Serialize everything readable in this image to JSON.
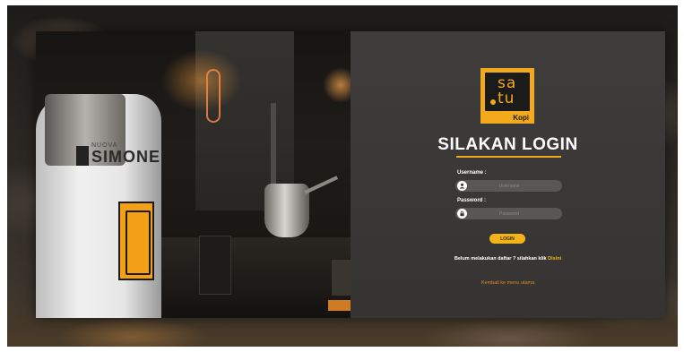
{
  "logo": {
    "line1": "sa",
    "line2": "tu",
    "sub": "Kopi"
  },
  "photo": {
    "brand_small": "NUOVA",
    "brand_name": "SIMONE"
  },
  "login": {
    "title": "SILAKAN LOGIN",
    "username_label": "Username :",
    "username_placeholder": "Username",
    "password_label": "Password :",
    "password_placeholder": "Password",
    "login_button": "LOGIN",
    "register_text": "Belum melakukan daftar ? silahkan klik",
    "register_link": "Disini",
    "back_link": "Kembali ke menu utama"
  },
  "colors": {
    "accent": "#f2a91c",
    "panel": "#3b3937",
    "link_orange": "#e0862a"
  },
  "icons": {
    "username": "user-icon",
    "password": "lock-icon"
  }
}
